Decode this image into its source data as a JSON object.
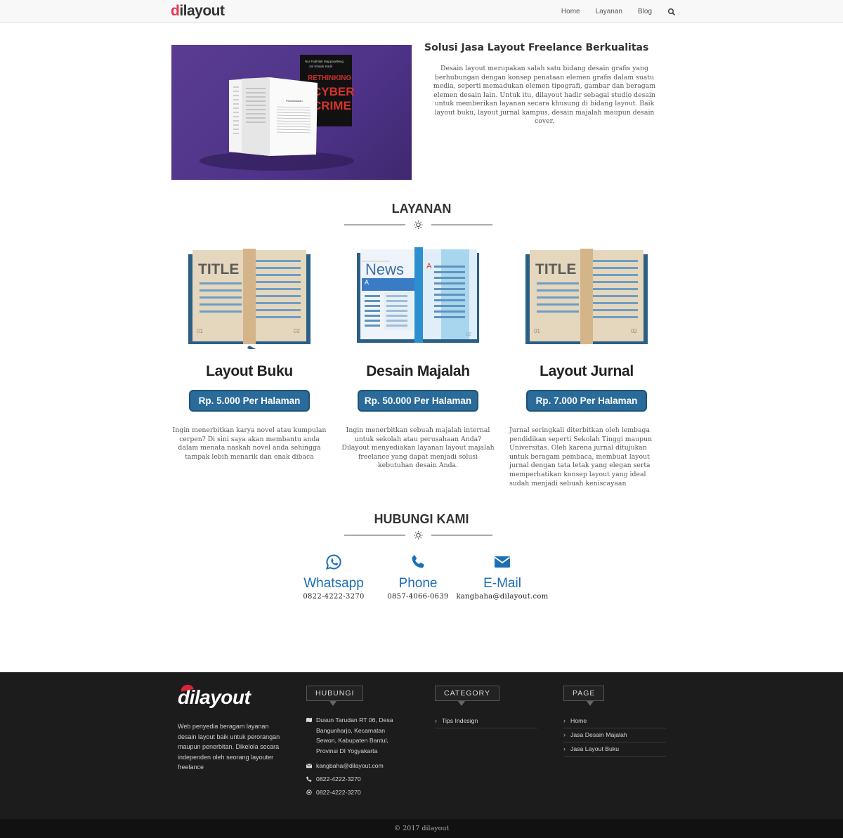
{
  "nav": {
    "logo_prefix": "d",
    "logo_rest": "ilayout",
    "links": [
      "Home",
      "Layanan",
      "Blog"
    ]
  },
  "intro": {
    "title": "Solusi Jasa Layout Freelance Berkualitas",
    "text": "Desain layout merupakan salah satu bidang desain grafis yang berhubungan dengan konsep penataan elemen grafis dalam suatu media, seperti memadukan elemen tipografi, gambar dan beragam elemen desain lain. Untuk itu, dilayout  hadir sebagai studio desain untuk memberikan layanan secara khusung di bidang layout. Baik layout buku, layout jurnal kampus, desain majalah maupun desain cover.",
    "book_cover_text": [
      "Nur Fadhilah Mappaselleng",
      "Zul Khaidir Kadir",
      "RETHINKING",
      "CYBER",
      "CRIME"
    ],
    "book_page_heading": "Pendahuluan"
  },
  "layanan": {
    "title": "LAYANAN",
    "items": [
      {
        "name": "Layout Buku",
        "price": "Rp. 5.000 Per Halaman",
        "desc": "Ingin menerbitkan karya novel atau kumpulan cerpen? Di sini saya akan membantu anda dalam menata naskah novel anda sehingga tampak lebih menarik dan enak dibaca",
        "book_title": "TITLE",
        "page_left": "01",
        "page_right": "02"
      },
      {
        "name": "Desain Majalah",
        "price": "Rp. 50.000 Per Halaman",
        "desc": "Ingin menerbitkan sebuah majalah internal untuk sekolah atau perusahaan Anda? Dilayout menyediakan layanan layout majalah freelance yang dapat menjadi solusi kebutuhan desain Anda.",
        "book_title": "News",
        "letter": "A",
        "page_right": "02"
      },
      {
        "name": "Layout Jurnal",
        "price": "Rp. 7.000 Per Halaman",
        "desc": "Jurnal seringkali diterbitkan oleh lembaga pendidikan seperti Sekolah Tinggi maupun Universitas. Oleh karena jurnal ditujukan untuk beragam pembaca, membuat layout jurnal dengan tata letak yang elegan serta memperhatikan konsep layout yang ideal sudah menjadi sebuah keniscayaan",
        "book_title": "TITLE",
        "page_left": "01",
        "page_right": "02"
      }
    ]
  },
  "hubungi": {
    "title": "HUBUNGI KAMI",
    "items": [
      {
        "label": "Whatsapp",
        "value": "0822-4222-3270",
        "icon": "whatsapp-icon"
      },
      {
        "label": "Phone",
        "value": "0857-4066-0639",
        "icon": "phone-icon"
      },
      {
        "label": "E-Mail",
        "value": "kangbaha@dilayout.com",
        "icon": "mail-icon"
      }
    ]
  },
  "footer": {
    "logo": "dilayout",
    "about": "Web penyedia beragam layanan desain layout baik untuk perorangan maupun penerbitan. Dikelola secara independen oleh seorang layouter freelance",
    "hubungi": {
      "heading": "HUBUNGI",
      "address": "Dusun Tarudan RT 06, Desa Bangunharjo, Kecamatan Sewon, Kabupaten Bantul, Provinsi DI Yogyakarta",
      "email": "kangbaha@dilayout.com",
      "phone": "0822-4222-3270",
      "whatsapp": "0822-4222-3270"
    },
    "category": {
      "heading": "CATEGORY",
      "items": [
        "Tips Indesign"
      ]
    },
    "page": {
      "heading": "PAGE",
      "items": [
        "Home",
        "Jasa Desain Majalah",
        "Jasa Layout Buku"
      ]
    },
    "copyright": "© 2017 dilayout"
  },
  "colors": {
    "accent_blue": "#2a6b9a",
    "contact_blue": "#1d6fb5",
    "logo_red": "#e8334e",
    "hero_purple": "#4e3389",
    "footer_bg": "#1c1c1c"
  }
}
